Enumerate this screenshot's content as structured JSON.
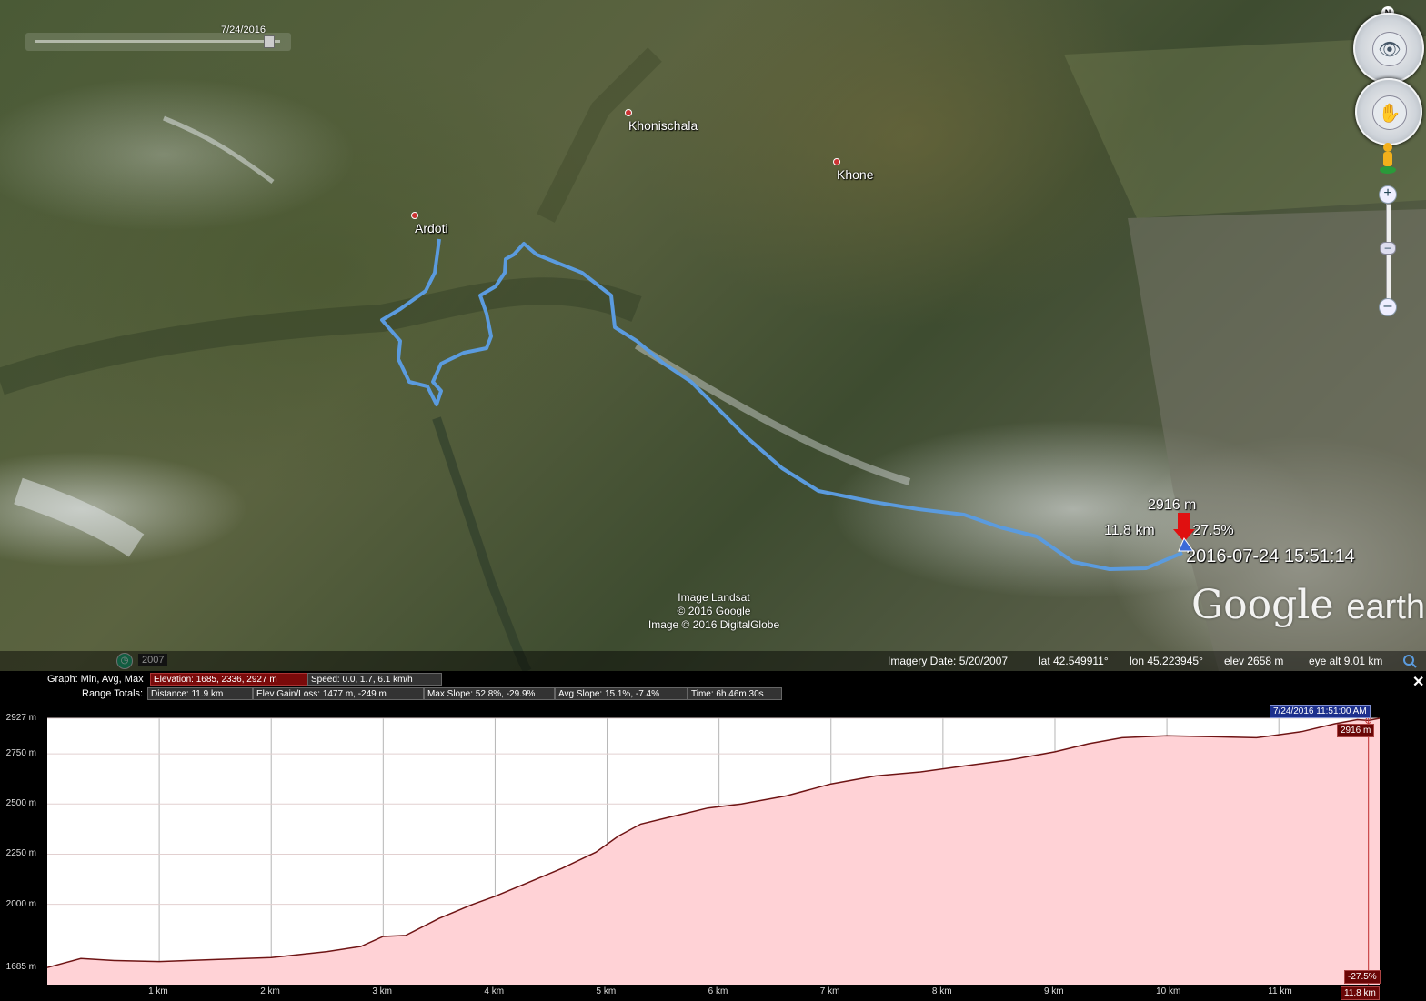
{
  "map": {
    "places": [
      {
        "name": "Ardoti"
      },
      {
        "name": "Khonischala"
      },
      {
        "name": "Khone"
      }
    ],
    "credits": [
      "Image Landsat",
      "© 2016 Google",
      "Image © 2016 DigitalGlobe"
    ],
    "logo": {
      "google": "Google",
      "earth": "earth"
    },
    "cursor": {
      "elevation": "2916 m",
      "distance": "11.8 km",
      "slope": "-27.5%",
      "timestamp": "2016-07-24 15:51:14"
    },
    "time_slider_date": "7/24/2016",
    "north_label": "N",
    "colors": {
      "track": "#5b9bde",
      "marker": "#e01010"
    }
  },
  "statusbar": {
    "imagery_date": "Imagery Date: 5/20/2007",
    "lat": "lat   42.549911°",
    "lon": "lon   45.223945°",
    "elev": "elev   2658 m",
    "eye_alt": "eye alt    9.01 km",
    "historical_year": "2007"
  },
  "profile": {
    "graph_caption": "Graph:  Min, Avg, Max",
    "elevation": "Elevation:  1685, 2336, 2927 m",
    "speed": "Speed:  0.0,  1.7, 6.1 km/h",
    "range_caption": "Range Totals:",
    "distance": "Distance:  11.9 km",
    "elev_gain_loss": "Elev Gain/Loss:  1477 m, -249 m",
    "max_slope": "Max Slope:  52.8%, -29.9%",
    "avg_slope": "Avg Slope:  15.1%, -7.4%",
    "time": "Time:  6h 46m 30s",
    "close": "✕",
    "cursor_time": "7/24/2016 11:51:00 AM",
    "cursor_elev": "2916 m",
    "cursor_slope": "-27.5%",
    "cursor_dist": "11.8 km"
  },
  "chart_data": {
    "type": "area",
    "title": "",
    "xlabel": "",
    "ylabel": "",
    "xlim": [
      0,
      11.9
    ],
    "ylim": [
      1600,
      2927
    ],
    "y_ticks": [
      {
        "value": 2927,
        "label": "2927 m"
      },
      {
        "value": 2750,
        "label": "2750 m"
      },
      {
        "value": 2500,
        "label": "2500 m"
      },
      {
        "value": 2250,
        "label": "2250 m"
      },
      {
        "value": 2000,
        "label": "2000 m"
      },
      {
        "value": 1685,
        "label": "1685 m"
      }
    ],
    "x_ticks": [
      {
        "value": 1,
        "label": "1 km"
      },
      {
        "value": 2,
        "label": "2 km"
      },
      {
        "value": 3,
        "label": "3 km"
      },
      {
        "value": 4,
        "label": "4 km"
      },
      {
        "value": 5,
        "label": "5 km"
      },
      {
        "value": 6,
        "label": "6 km"
      },
      {
        "value": 7,
        "label": "7 km"
      },
      {
        "value": 8,
        "label": "8 km"
      },
      {
        "value": 9,
        "label": "9 km"
      },
      {
        "value": 10,
        "label": "10 km"
      },
      {
        "value": 11,
        "label": "11 km"
      }
    ],
    "x": [
      0,
      0.3,
      0.6,
      1.0,
      1.5,
      2.0,
      2.5,
      2.8,
      3.0,
      3.2,
      3.5,
      3.8,
      4.0,
      4.3,
      4.6,
      4.9,
      5.1,
      5.3,
      5.6,
      5.9,
      6.2,
      6.6,
      7.0,
      7.4,
      7.8,
      8.2,
      8.6,
      9.0,
      9.3,
      9.6,
      10.0,
      10.4,
      10.8,
      11.2,
      11.5,
      11.7,
      11.8,
      11.9
    ],
    "y": [
      1685,
      1730,
      1720,
      1715,
      1725,
      1735,
      1765,
      1790,
      1840,
      1845,
      1930,
      2000,
      2040,
      2110,
      2180,
      2260,
      2340,
      2400,
      2440,
      2480,
      2500,
      2540,
      2600,
      2640,
      2660,
      2690,
      2720,
      2760,
      2800,
      2830,
      2840,
      2835,
      2830,
      2860,
      2900,
      2920,
      2916,
      2927
    ],
    "grid": true,
    "fill_color": "#ffd2d6",
    "line_color": "#6e1414"
  }
}
